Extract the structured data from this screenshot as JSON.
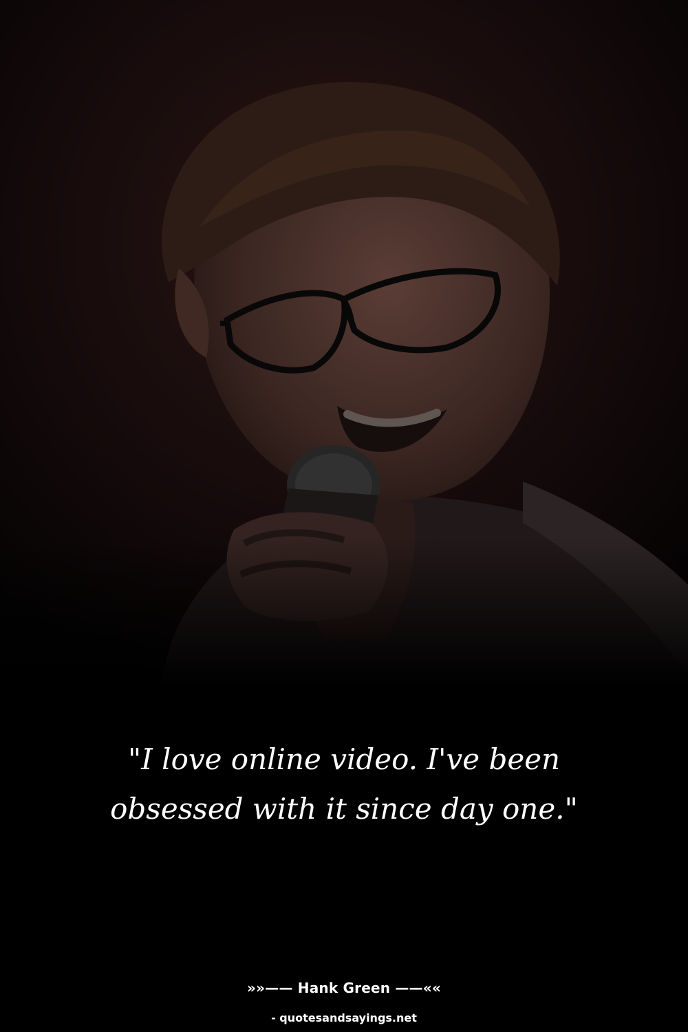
{
  "quote": {
    "text": "\"I love online video. I've been obsessed with it since day one.\""
  },
  "attribution": {
    "author": "»»—— Hank Green ——««",
    "source": "- quotesandsayings.net"
  },
  "colors": {
    "background": "#000000",
    "text": "#ffffff",
    "photo_tint": "#160b0b"
  },
  "photo": {
    "subject": "man with glasses smiling while holding a microphone"
  }
}
